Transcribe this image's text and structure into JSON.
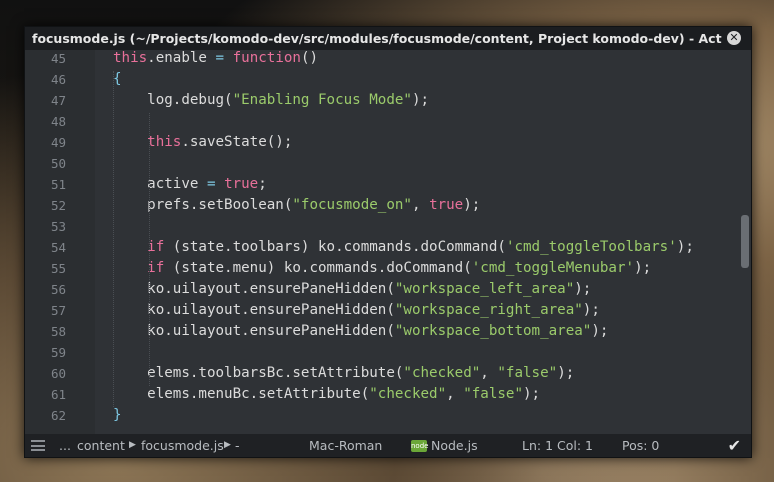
{
  "window": {
    "title": "focusmode.js (~/Projects/komodo-dev/src/modules/focusmode/content, Project komodo-dev) - ActiveState K...",
    "close_glyph": "✕"
  },
  "editor": {
    "lines": [
      {
        "num": "45",
        "tokens": [
          {
            "t": "this",
            "c": "kw"
          },
          {
            "t": ".enable ",
            "c": "prop"
          },
          {
            "t": "=",
            "c": "op"
          },
          {
            "t": " ",
            "c": "prop"
          },
          {
            "t": "function",
            "c": "kw"
          },
          {
            "t": "()",
            "c": "prop"
          }
        ]
      },
      {
        "num": "46",
        "tokens": [
          {
            "t": "{",
            "c": "brace"
          }
        ]
      },
      {
        "num": "47",
        "tokens": [
          {
            "t": "    log.debug(",
            "c": "prop"
          },
          {
            "t": "\"Enabling Focus Mode\"",
            "c": "str"
          },
          {
            "t": ");",
            "c": "prop"
          }
        ]
      },
      {
        "num": "48",
        "tokens": []
      },
      {
        "num": "49",
        "tokens": [
          {
            "t": "    ",
            "c": "prop"
          },
          {
            "t": "this",
            "c": "kw"
          },
          {
            "t": ".saveState();",
            "c": "prop"
          }
        ]
      },
      {
        "num": "50",
        "tokens": []
      },
      {
        "num": "51",
        "tokens": [
          {
            "t": "    active ",
            "c": "prop"
          },
          {
            "t": "=",
            "c": "op"
          },
          {
            "t": " ",
            "c": "prop"
          },
          {
            "t": "true",
            "c": "kw"
          },
          {
            "t": ";",
            "c": "prop"
          }
        ]
      },
      {
        "num": "52",
        "tokens": [
          {
            "t": "    prefs.setBoolean(",
            "c": "prop"
          },
          {
            "t": "\"focusmode_on\"",
            "c": "str"
          },
          {
            "t": ", ",
            "c": "prop"
          },
          {
            "t": "true",
            "c": "kw"
          },
          {
            "t": ");",
            "c": "prop"
          }
        ]
      },
      {
        "num": "53",
        "tokens": []
      },
      {
        "num": "54",
        "tokens": [
          {
            "t": "    ",
            "c": "prop"
          },
          {
            "t": "if",
            "c": "kw"
          },
          {
            "t": " (state.toolbars) ko.commands.doCommand(",
            "c": "prop"
          },
          {
            "t": "'cmd_toggleToolbars'",
            "c": "sq"
          },
          {
            "t": ");",
            "c": "prop"
          }
        ]
      },
      {
        "num": "55",
        "tokens": [
          {
            "t": "    ",
            "c": "prop"
          },
          {
            "t": "if",
            "c": "kw"
          },
          {
            "t": " (state.menu) ko.commands.doCommand(",
            "c": "prop"
          },
          {
            "t": "'cmd_toggleMenubar'",
            "c": "sq"
          },
          {
            "t": ");",
            "c": "prop"
          }
        ]
      },
      {
        "num": "56",
        "tokens": [
          {
            "t": "    ko.uilayout.ensurePaneHidden(",
            "c": "prop"
          },
          {
            "t": "\"workspace_left_area\"",
            "c": "str"
          },
          {
            "t": ");",
            "c": "prop"
          }
        ]
      },
      {
        "num": "57",
        "tokens": [
          {
            "t": "    ko.uilayout.ensurePaneHidden(",
            "c": "prop"
          },
          {
            "t": "\"workspace_right_area\"",
            "c": "str"
          },
          {
            "t": ");",
            "c": "prop"
          }
        ]
      },
      {
        "num": "58",
        "tokens": [
          {
            "t": "    ko.uilayout.ensurePaneHidden(",
            "c": "prop"
          },
          {
            "t": "\"workspace_bottom_area\"",
            "c": "str"
          },
          {
            "t": ");",
            "c": "prop"
          }
        ]
      },
      {
        "num": "59",
        "tokens": []
      },
      {
        "num": "60",
        "tokens": [
          {
            "t": "    elems.toolbarsBc.setAttribute(",
            "c": "prop"
          },
          {
            "t": "\"checked\"",
            "c": "str"
          },
          {
            "t": ", ",
            "c": "prop"
          },
          {
            "t": "\"false\"",
            "c": "str"
          },
          {
            "t": ");",
            "c": "prop"
          }
        ]
      },
      {
        "num": "61",
        "tokens": [
          {
            "t": "    elems.menuBc.setAttribute(",
            "c": "prop"
          },
          {
            "t": "\"checked\"",
            "c": "str"
          },
          {
            "t": ", ",
            "c": "prop"
          },
          {
            "t": "\"false\"",
            "c": "str"
          },
          {
            "t": ");",
            "c": "prop"
          }
        ]
      },
      {
        "num": "62",
        "tokens": [
          {
            "t": "}",
            "c": "brace"
          }
        ]
      }
    ]
  },
  "statusbar": {
    "ellipsis": "...",
    "breadcrumb_folder": "content",
    "breadcrumb_file": "focusmode.js",
    "breadcrumb_symbol": "-",
    "encoding": "Mac-Roman",
    "language": "Node.js",
    "language_badge": "node",
    "position": "Ln: 1 Col: 1",
    "pos": "Pos: 0"
  },
  "colors": {
    "keyword": "#e8709a",
    "string": "#9bcb6b",
    "operator": "#7ec8e3",
    "editor_bg": "#2f3236"
  },
  "icons": {
    "menu": "hamburger-icon",
    "breadcrumb_sep": "triangle-right-icon",
    "language": "nodejs-icon",
    "sync": "check-icon"
  }
}
